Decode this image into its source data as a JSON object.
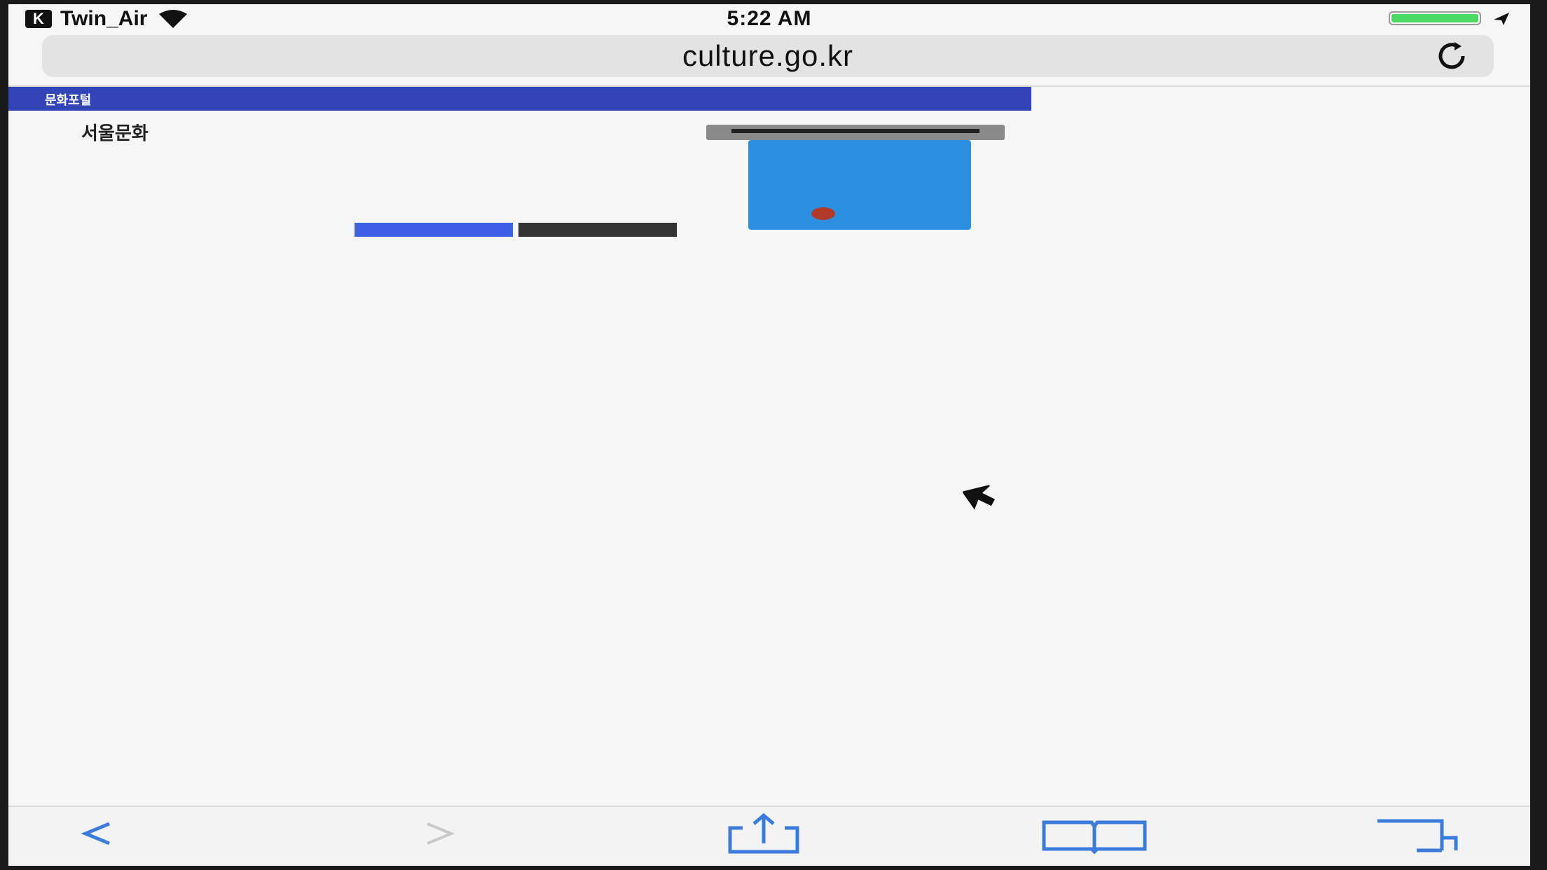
{
  "status_bar": {
    "carrier": "Twin_Air",
    "carrier_badge": "K",
    "time": "5:22 AM",
    "battery_level": 1.0
  },
  "url_bar": {
    "url": "culture.go.kr"
  },
  "page": {
    "header_title": "문화포털",
    "header_subtitle": "",
    "content_title": "서울문화",
    "info_rows": [
      {
        "label": "",
        "value": ""
      },
      {
        "label": "",
        "value": ""
      },
      {
        "label": "",
        "value": ""
      },
      {
        "label": "",
        "value": ""
      },
      {
        "label": "",
        "value": ""
      }
    ],
    "primary_button": "",
    "secondary_button": "",
    "banner": {
      "line1": "",
      "line2": "",
      "headline": "",
      "foot": ""
    }
  },
  "colors": {
    "header": "#3344b8",
    "primary_button": "#3f5fe6",
    "banner": "#2d8fe0",
    "toolbar_icon": "#3a7bdc"
  },
  "icons": [
    "wifi-icon",
    "battery-icon",
    "reload-icon",
    "cursor-icon",
    "back-icon",
    "forward-icon",
    "share-icon",
    "bookmarks-icon",
    "tabs-icon"
  ]
}
